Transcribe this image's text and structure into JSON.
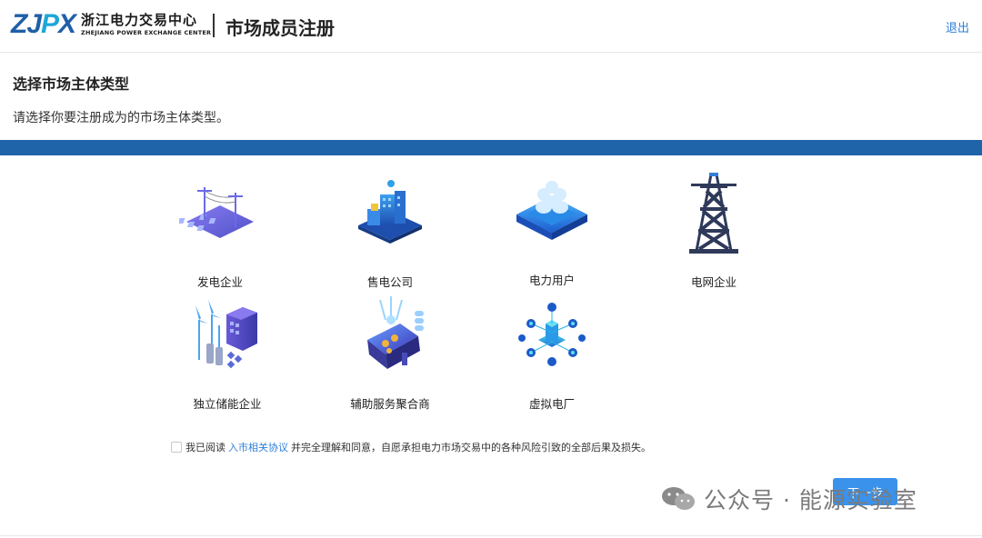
{
  "header": {
    "logo_mark_a": "ZJ",
    "logo_mark_b": "P",
    "logo_mark_c": "X",
    "logo_cn": "浙江电力交易中心",
    "logo_en": "ZHEJIANG POWER EXCHANGE CENTER",
    "title": "市场成员注册",
    "logout": "退出"
  },
  "section": {
    "title": "选择市场主体类型",
    "description": "请选择你要注册成为的市场主体类型。"
  },
  "entity_types": [
    {
      "label": "发电企业",
      "icon": "power-generation-icon"
    },
    {
      "label": "售电公司",
      "icon": "electricity-retail-icon"
    },
    {
      "label": "电力用户",
      "icon": "power-user-icon"
    },
    {
      "label": "电网企业",
      "icon": "power-grid-tower-icon"
    },
    {
      "label": "独立储能企业",
      "icon": "energy-storage-icon"
    },
    {
      "label": "辅助服务聚合商",
      "icon": "ancillary-service-icon"
    },
    {
      "label": "虚拟电厂",
      "icon": "virtual-power-plant-icon"
    }
  ],
  "agreement": {
    "prefix": "我已阅读",
    "link": "入市相关协议",
    "suffix": "并完全理解和同意，自愿承担电力市场交易中的各种风险引致的全部后果及损失。",
    "checked": false
  },
  "next_button": "下一步",
  "watermark": "公众号 · 能源实验室",
  "colors": {
    "brand_blue": "#1f63a8",
    "link_blue": "#2f7fd6",
    "button_blue": "#3a92ea"
  }
}
